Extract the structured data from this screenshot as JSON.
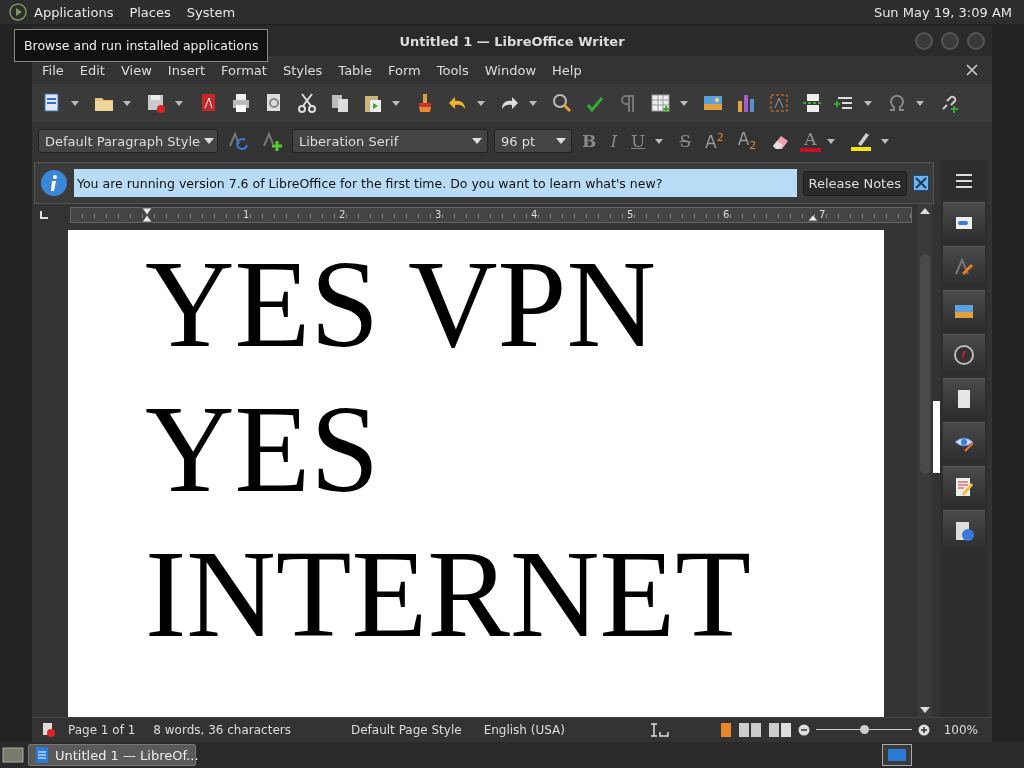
{
  "top_panel": {
    "menus": [
      "Applications",
      "Places",
      "System"
    ],
    "clock": "Sun May 19, 3:09 AM"
  },
  "tooltip": "Browse and run installed applications",
  "window": {
    "title": "Untitled 1 — LibreOffice Writer"
  },
  "menu_bar": [
    "File",
    "Edit",
    "View",
    "Insert",
    "Format",
    "Styles",
    "Table",
    "Form",
    "Tools",
    "Window",
    "Help"
  ],
  "formatting_bar": {
    "paragraph_style": "Default Paragraph Style",
    "font_name": "Liberation Serif",
    "font_size": "96 pt",
    "buttons": [
      {
        "kind": "bold",
        "label": "B"
      },
      {
        "kind": "italic",
        "label": "I"
      },
      {
        "kind": "underline",
        "label": "U"
      },
      {
        "kind": "strike",
        "label": "S"
      },
      {
        "kind": "super",
        "label": "A$^{2}$"
      },
      {
        "kind": "sub",
        "label": "A$_{2}$"
      },
      {
        "kind": "clear"
      },
      {
        "kind": "fontcolor",
        "label": "A",
        "color": "#c8102e"
      },
      {
        "kind": "highlight",
        "color": "#f5e50a"
      }
    ]
  },
  "infobar": {
    "message": "You are running version 7.6 of LibreOffice for the first time. Do you want to learn what's new?",
    "button": "Release Notes"
  },
  "ruler": [
    "1",
    "2",
    "3",
    "4",
    "5",
    "6",
    "7"
  ],
  "document": {
    "paragraphs": [
      "YES VPN",
      "YES",
      "INTERNET"
    ]
  },
  "status_bar": {
    "page": "Page 1 of 1",
    "count": "8 words, 36 characters",
    "page_style": "Default Page Style",
    "language": "English (USA)",
    "zoom": {
      "level": 0.5,
      "reading": "100%"
    }
  },
  "taskbar": {
    "tasks": [
      {
        "label": "Untitled 1 — LibreOf...",
        "selected": true
      }
    ]
  }
}
